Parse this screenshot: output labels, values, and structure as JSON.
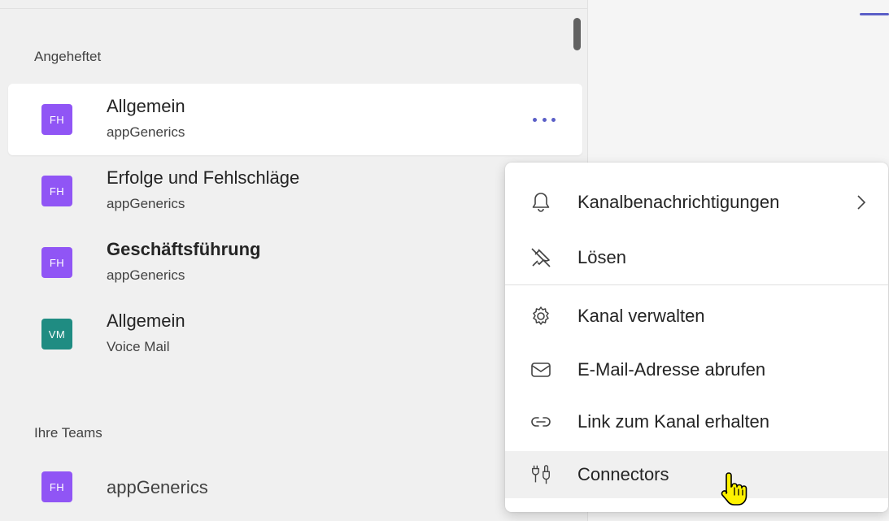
{
  "sidebar": {
    "pinned_label": "Angeheftet",
    "teams_label": "Ihre Teams",
    "pinned": [
      {
        "avatar": "FH",
        "title": "Allgemein",
        "subtitle": "appGenerics"
      },
      {
        "avatar": "FH",
        "title": "Erfolge und Fehlschläge",
        "subtitle": "appGenerics"
      },
      {
        "avatar": "FH",
        "title": "Geschäftsführung",
        "subtitle": "appGenerics"
      },
      {
        "avatar": "VM",
        "title": "Allgemein",
        "subtitle": "Voice Mail"
      }
    ],
    "teams": [
      {
        "avatar": "FH",
        "title": "appGenerics"
      }
    ],
    "more_icon": "more-horizontal-icon"
  },
  "context_menu": {
    "items": [
      {
        "label": "Kanalbenachrichtigungen",
        "icon": "bell-icon",
        "has_submenu": true
      },
      {
        "label": "Lösen",
        "icon": "unpin-icon"
      },
      {
        "label": "Kanal verwalten",
        "icon": "gear-icon"
      },
      {
        "label": "E-Mail-Adresse abrufen",
        "icon": "mail-icon"
      },
      {
        "label": "Link zum Kanal erhalten",
        "icon": "link-icon"
      },
      {
        "label": "Connectors",
        "icon": "connector-icon",
        "hovered": true
      }
    ]
  },
  "colors": {
    "accent": "#5b5fc7",
    "avatar_purple": "#9055f5",
    "avatar_teal": "#1f8c82"
  }
}
